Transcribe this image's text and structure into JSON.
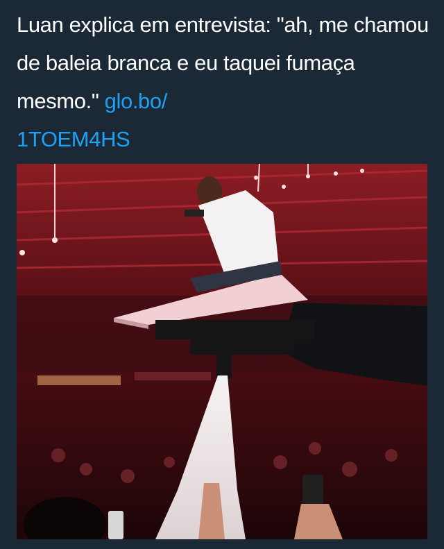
{
  "tweet": {
    "text": "Luan explica em entrevista: \"ah, me chamou de baleia branca e eu taquei fumaça mesmo.\" ",
    "link_text": "glo.bo/\n1TOEM4HS"
  },
  "colors": {
    "background": "#1b2836",
    "text": "#ffffff",
    "link": "#1da1f2"
  },
  "media": {
    "icon": "concert-photo-icon"
  }
}
